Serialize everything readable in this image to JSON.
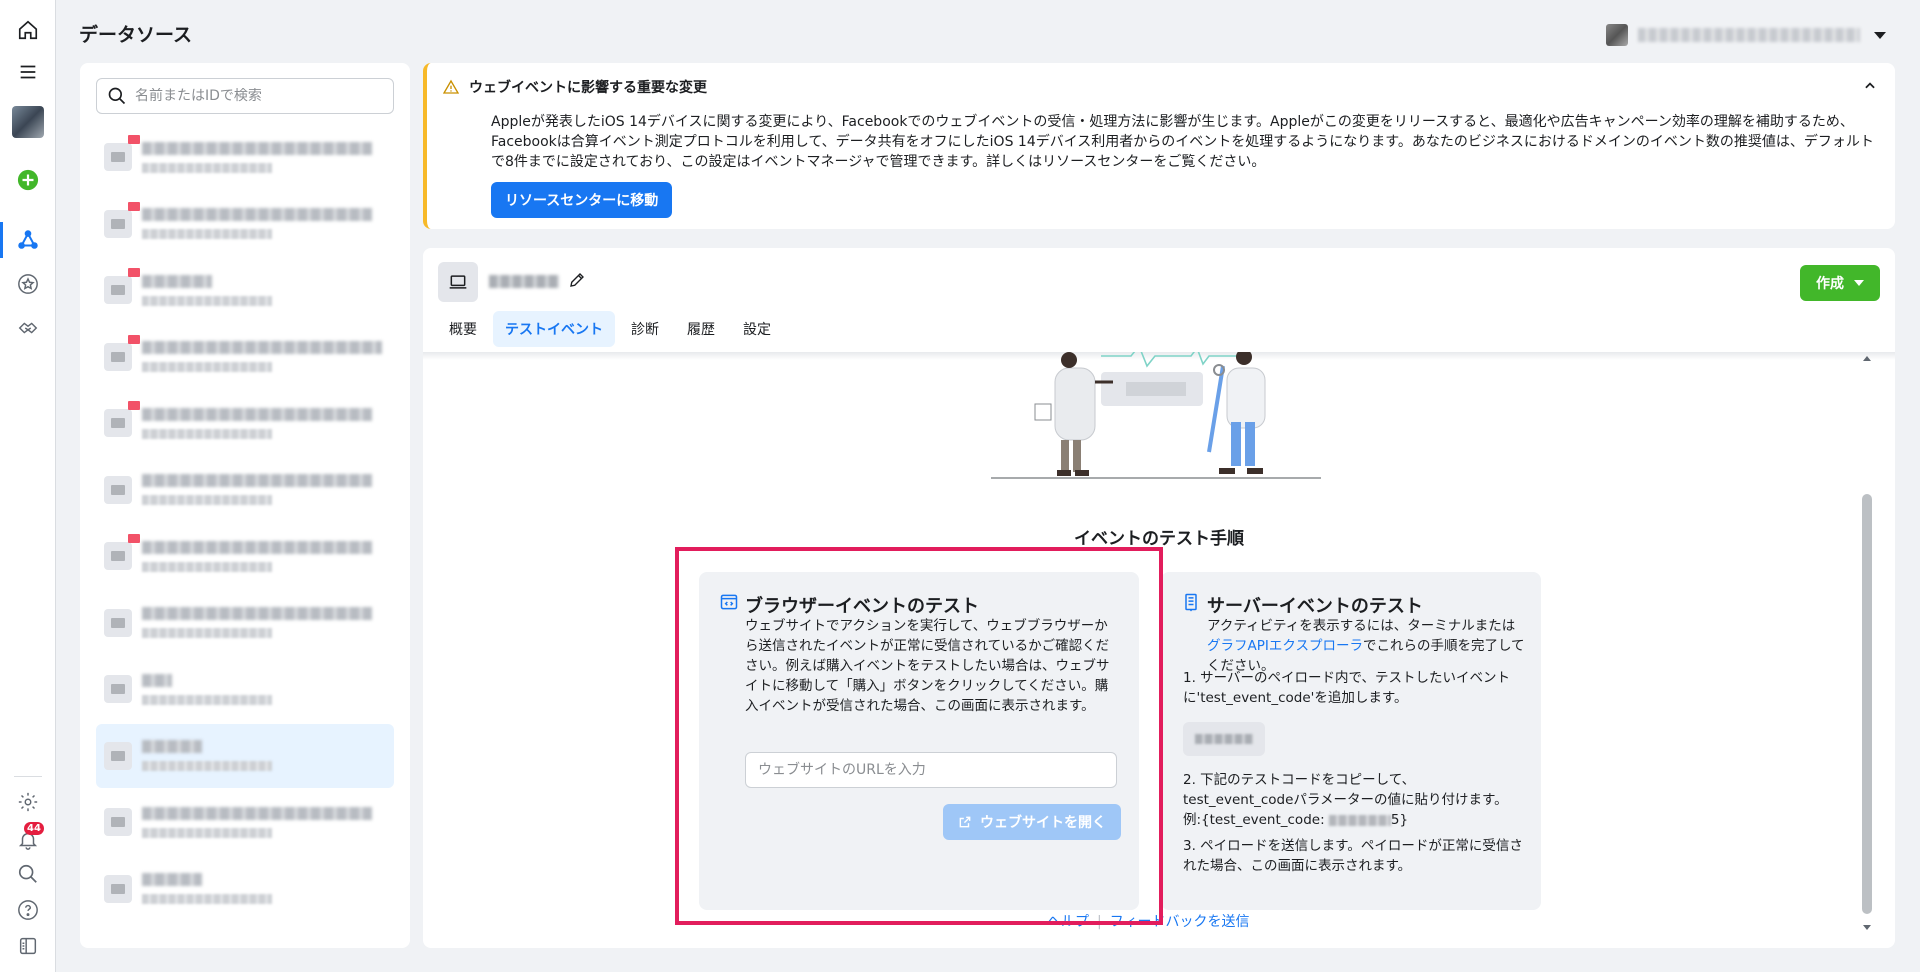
{
  "page": {
    "title": "データソース"
  },
  "rail": {
    "notifications_count": "44",
    "icons": [
      "home-icon",
      "menu-icon",
      "avatar",
      "add-icon",
      "events-manager-icon",
      "star-icon",
      "partner-icon",
      "settings-icon",
      "notifications-icon",
      "search-icon",
      "help-icon",
      "sidebar-toggle-icon"
    ]
  },
  "list": {
    "search_placeholder": "名前またはIDで検索",
    "items_count": 12,
    "selected_index": 9
  },
  "notice": {
    "title": "ウェブイベントに影響する重要な変更",
    "body": "Appleが発表したiOS 14デバイスに関する変更により、Facebookでのウェブイベントの受信・処理方法に影響が生じます。Appleがこの変更をリリースすると、最適化や広告キャンペーン効率の理解を補助するため、Facebookは合算イベント測定プロトコルを利用して、データ共有をオフにしたiOS 14デバイス利用者からのイベントを処理するようになります。あなたのビジネスにおけるドメインのイベント数の推奨値は、デフォルトで8件までに設定されており、この設定はイベントマネージャで管理できます。詳しくはリソースセンターをご覧ください。",
    "button": "リソースセンターに移動"
  },
  "toolbar": {
    "create_label": "作成",
    "tabs": [
      "概要",
      "テストイベント",
      "診断",
      "履歴",
      "設定"
    ],
    "active_tab": "テストイベント"
  },
  "main": {
    "section_title": "イベントのテスト手順",
    "browser": {
      "title": "ブラウザーイベントのテスト",
      "description": "ウェブサイトでアクションを実行して、ウェブブラウザーから送信されたイベントが正常に受信されているかご確認ください。例えば購入イベントをテストしたい場合は、ウェブサイトに移動して「購入」ボタンをクリックしてください。購入イベントが受信された場合、この画面に表示されます。",
      "url_placeholder": "ウェブサイトのURLを入力",
      "open_button": "ウェブサイトを開く"
    },
    "server": {
      "title": "サーバーイベントのテスト",
      "intro_before": "アクティビティを表示するには、ターミナルまたは",
      "intro_link": "グラフAPIエクスプローラ",
      "intro_after": "でこれらの手順を完了してください。",
      "step1": "1. サーバーのペイロード内で、テストしたいイベントに'test_event_code'を追加します。",
      "step2_before": "2. 下記のテストコードをコピーして、test_event_codeパラメーターの値に貼り付けます。例:{test_event_code:",
      "step2_after": "5}",
      "step3": "3. ペイロードを送信します。ペイロードが正常に受信された場合、この画面に表示されます。"
    },
    "footer": {
      "help": "ヘルプ",
      "feedback": "フィードバックを送信"
    }
  },
  "colors": {
    "accent": "#1877f2",
    "create": "#42b72a",
    "warning": "#f7b928",
    "highlight": "#e21d5c"
  }
}
